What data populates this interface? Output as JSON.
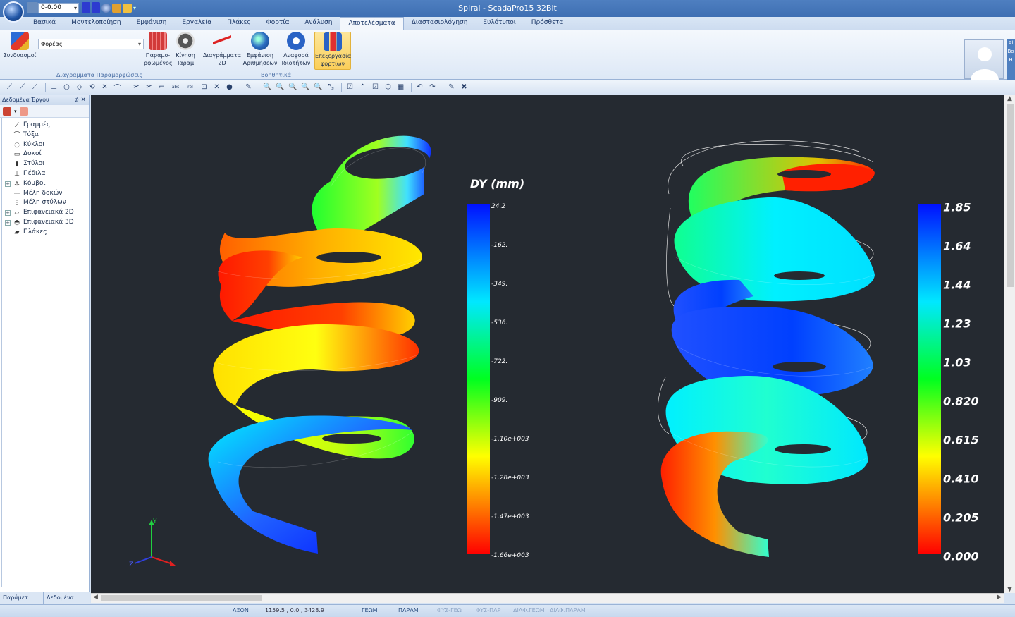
{
  "window": {
    "title": "Spiral - ScadaPro15 32Bit"
  },
  "quick_access": {
    "combo_value": "0-0.00"
  },
  "ribbon": {
    "tabs": [
      "Βασικά",
      "Μοντελοποίηση",
      "Εμφάνιση",
      "Εργαλεία",
      "Πλάκες",
      "Φορτία",
      "Ανάλυση",
      "Αποτελέσματα",
      "Διαστασιολόγηση",
      "Ξυλότυποι",
      "Πρόσθετα"
    ],
    "active_tab": "Αποτελέσματα",
    "group1": {
      "label": "Διαγράμματα Παραμορφώσεις",
      "combinations_label": "Συνδυασμοί",
      "carrier_combo_value": "Φορέας",
      "deformed_label_1": "Παραμο-",
      "deformed_label_2": "ρφωμένος",
      "motion_label_1": "Κίνηση",
      "motion_label_2": "Παραμ."
    },
    "group2": {
      "label": "Βοηθητικά",
      "diagrams_label_1": "Διαγράμματα",
      "diagrams_label_2": "2D",
      "show_label_1": "Εμφάνιση",
      "show_label_2": "Αριθμήσεων",
      "report_label_1": "Αναφορά",
      "report_label_2": "Ιδιοτήτων",
      "loads_label_1": "Επεξεργασία",
      "loads_label_2": "φορτίων"
    }
  },
  "side_edge_text": "Al Bo H",
  "panel": {
    "title": "Δεδομένα Έργου",
    "tree": [
      {
        "label": "Γραμμές",
        "icon": "line-icon",
        "expandable": false
      },
      {
        "label": "Τόξα",
        "icon": "arc-icon",
        "expandable": false
      },
      {
        "label": "Κύκλοι",
        "icon": "circle-icon",
        "expandable": false
      },
      {
        "label": "Δοκοί",
        "icon": "beam-icon",
        "expandable": false
      },
      {
        "label": "Στύλοι",
        "icon": "column-icon",
        "expandable": false
      },
      {
        "label": "Πέδιλα",
        "icon": "footing-icon",
        "expandable": false
      },
      {
        "label": "Κόμβοι",
        "icon": "node-icon",
        "expandable": true
      },
      {
        "label": "Μέλη δοκών",
        "icon": "beam-member-icon",
        "expandable": false
      },
      {
        "label": "Μέλη στύλων",
        "icon": "column-member-icon",
        "expandable": false
      },
      {
        "label": "Επιφανειακά 2D",
        "icon": "surface-2d-icon",
        "expandable": true
      },
      {
        "label": "Επιφανειακά 3D",
        "icon": "surface-3d-icon",
        "expandable": true
      },
      {
        "label": "Πλάκες",
        "icon": "slab-icon",
        "expandable": false
      }
    ],
    "bottom_tabs": [
      "Παράμετ...",
      "Δεδομένα..."
    ]
  },
  "viewport": {
    "left_legend": {
      "title": "DY (mm)",
      "labels": [
        "24.2",
        "-162.",
        "-349.",
        "-536.",
        "-722.",
        "-909.",
        "-1.10e+003",
        "-1.28e+003",
        "-1.47e+003",
        "-1.66e+003"
      ]
    },
    "right_legend": {
      "labels": [
        "1.85",
        "1.64",
        "1.44",
        "1.23",
        "1.03",
        "0.820",
        "0.615",
        "0.410",
        "0.205",
        "0.000"
      ]
    },
    "axis_labels": {
      "y": "Y",
      "z": "Z"
    }
  },
  "status": {
    "axis": "ΑΞΟΝ",
    "coords": "1159.5 , 0.0 , 3428.9",
    "geom": "ΓΕΩΜ",
    "param": "ΠΑΡΑΜ",
    "fys_geo": "ΦΥΣ-ΓΕΩ",
    "fys_par": "ΦΥΣ-ΠΑΡ",
    "diaf_geom": "ΔΙΑΦ.ΓΕΩΜ",
    "diaf_param": "ΔΙΑΦ.ΠΑΡΑΜ"
  },
  "colors": {
    "viewport_bg": "#252a31",
    "ribbon_accent": "#4e7fc0",
    "highlight": "#fbcf5a"
  }
}
